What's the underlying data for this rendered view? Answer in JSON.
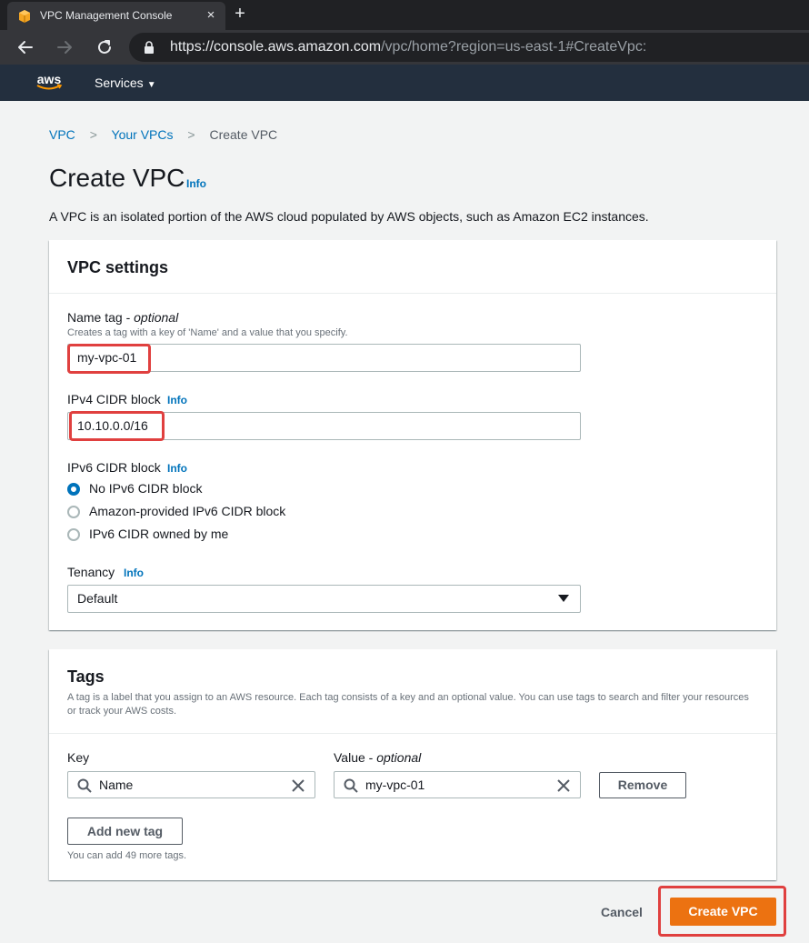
{
  "browser": {
    "tab_title": "VPC Management Console",
    "tab_close": "×",
    "new_tab": "+",
    "url_host": "https://console.aws.amazon.com",
    "url_path": "/vpc/home?region=us-east-1#CreateVpc:"
  },
  "aws_header": {
    "logo": "aws",
    "services_label": "Services",
    "services_caret": "▼"
  },
  "breadcrumb": {
    "items": [
      "VPC",
      "Your VPCs",
      "Create VPC"
    ],
    "separator": ">"
  },
  "page": {
    "title": "Create VPC",
    "info": "Info",
    "description": "A VPC is an isolated portion of the AWS cloud populated by AWS objects, such as Amazon EC2 instances."
  },
  "vpc_settings": {
    "title": "VPC settings",
    "name_tag_label": "Name tag - ",
    "name_tag_optional": "optional",
    "name_tag_hint": "Creates a tag with a key of 'Name' and a value that you specify.",
    "name_tag_value": "my-vpc-01",
    "ipv4_label": "IPv4 CIDR block",
    "ipv4_info": "Info",
    "ipv4_value": "10.10.0.0/16",
    "ipv6_label": "IPv6 CIDR block",
    "ipv6_info": "Info",
    "ipv6_options": [
      "No IPv6 CIDR block",
      "Amazon-provided IPv6 CIDR block",
      "IPv6 CIDR owned by me"
    ],
    "ipv6_selected_index": 0,
    "tenancy_label": "Tenancy",
    "tenancy_info": "Info",
    "tenancy_value": "Default"
  },
  "tags": {
    "title": "Tags",
    "description": "A tag is a label that you assign to an AWS resource. Each tag consists of a key and an optional value. You can use tags to search and filter your resources or track your AWS costs.",
    "key_label": "Key",
    "value_label": "Value - ",
    "value_optional": "optional",
    "key_value": "Name",
    "value_value": "my-vpc-01",
    "remove_label": "Remove",
    "add_label": "Add new tag",
    "remaining_hint": "You can add 49 more tags."
  },
  "footer": {
    "cancel_label": "Cancel",
    "create_label": "Create VPC"
  },
  "colors": {
    "aws_header": "#232f3e",
    "link": "#0073bb",
    "primary": "#ec7211",
    "highlight": "#e0403f"
  }
}
